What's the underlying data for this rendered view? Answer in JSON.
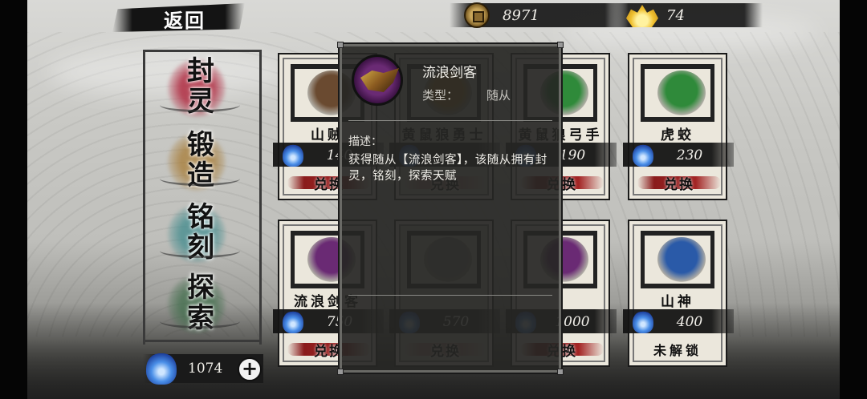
{
  "topbar": {
    "back_label": "返回",
    "coins": "8971",
    "gold": "74"
  },
  "menu": {
    "items": [
      {
        "label": "封灵",
        "color": "#b2364a"
      },
      {
        "label": "锻造",
        "color": "#a77b35"
      },
      {
        "label": "铭刻",
        "color": "#3f8a8c"
      },
      {
        "label": "探索",
        "color": "#3f6c4a"
      }
    ]
  },
  "soul": {
    "value": "1074",
    "plus_label": "+"
  },
  "cards": [
    {
      "name": "山贼",
      "cost": "140",
      "action": "兑换",
      "portrait": "#6a4a30",
      "dim": false
    },
    {
      "name": "黄鼠狼勇士",
      "cost": "",
      "action": "兑换",
      "portrait": "#b8862a",
      "dim": true
    },
    {
      "name": "黄鼠狼弓手",
      "cost": "190",
      "action": "兑换",
      "portrait": "#2f8a3a",
      "dim": false
    },
    {
      "name": "虎蛟",
      "cost": "230",
      "action": "兑换",
      "portrait": "#2f8a3a",
      "dim": false
    },
    {
      "name": "流浪剑客",
      "cost": "750",
      "action": "兑换",
      "portrait": "#6a2a74",
      "dim": false
    },
    {
      "name": "",
      "cost": "570",
      "action": "兑换",
      "portrait": "#888888",
      "dim": true
    },
    {
      "name": "",
      "cost": "1000",
      "action": "兑换",
      "portrait": "#6a2a74",
      "dim": false
    },
    {
      "name": "山神",
      "cost": "400",
      "action": "未解锁",
      "portrait": "#2a5aa8",
      "dim": false
    }
  ],
  "tooltip": {
    "name": "流浪剑客",
    "type_label": "类型：",
    "type_value": "随从",
    "desc_label": "描述：",
    "desc": "获得随从【流浪剑客】，该随从拥有封灵，铭刻，探索天赋"
  },
  "colors": {
    "soul_blue": "#4a8fe8",
    "redeem_red": "#a32525",
    "panel_dark": "#262624"
  }
}
